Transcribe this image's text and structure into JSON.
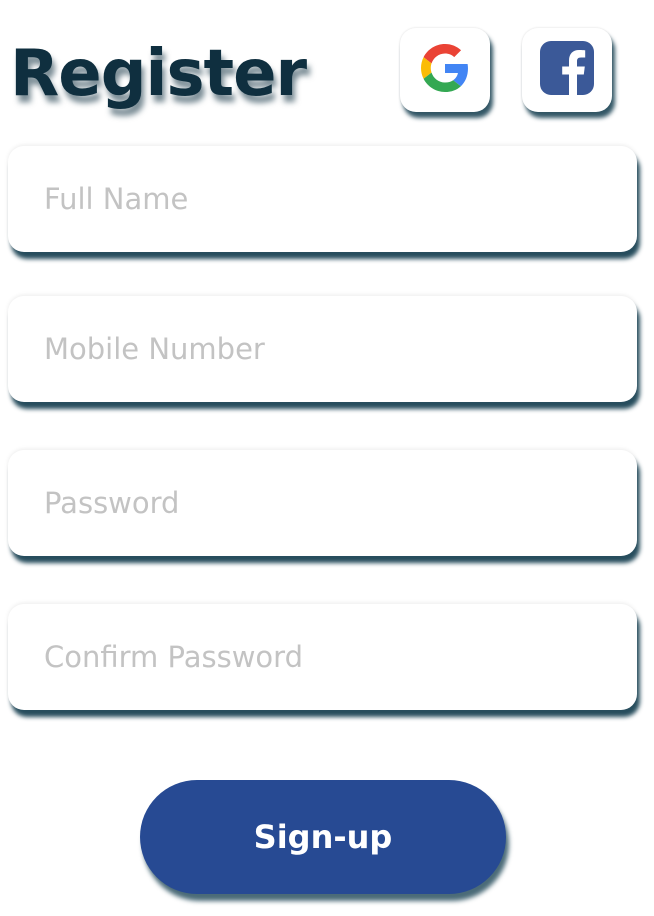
{
  "title": "Register",
  "social": {
    "google_icon": "google-icon",
    "facebook_icon": "facebook-icon"
  },
  "fields": {
    "full_name": {
      "placeholder": "Full Name",
      "value": ""
    },
    "mobile": {
      "placeholder": "Mobile Number",
      "value": ""
    },
    "password": {
      "placeholder": "Password",
      "value": ""
    },
    "confirm_password": {
      "placeholder": "Confirm Password",
      "value": ""
    }
  },
  "signup_label": "Sign-up",
  "colors": {
    "title": "#0f2f3f",
    "button": "#274a93",
    "shadow": "#0f3a4b",
    "facebook": "#3b5998"
  }
}
